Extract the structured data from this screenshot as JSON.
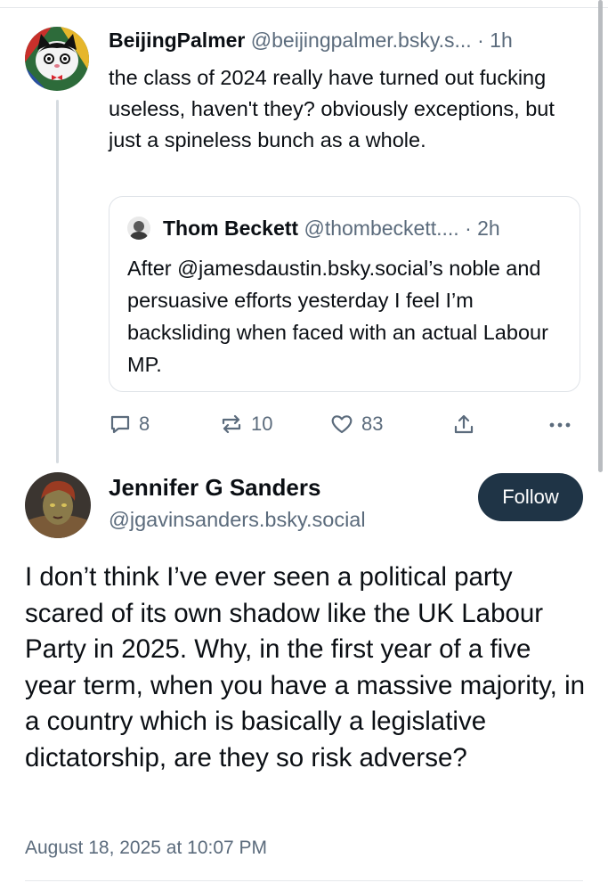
{
  "parent_post": {
    "author_name": "BeijingPalmer",
    "author_handle": "@beijingpalmer.bsky.s...",
    "separator": "·",
    "time": "1h",
    "text": "the class of 2024 really have turned out fucking useless, haven't they? obviously exceptions, but just a spineless bunch as a whole.",
    "quote": {
      "author_name": "Thom Beckett",
      "author_handle": "@thombeckett....",
      "separator": "·",
      "time": "2h",
      "text": "After @jamesdaustin.bsky.social’s noble and persuasive efforts yesterday I feel I’m backsliding when faced with an actual Labour MP."
    },
    "actions": {
      "reply_count": "8",
      "repost_count": "10",
      "like_count": "83",
      "icons": [
        "reply-icon",
        "repost-icon",
        "like-icon",
        "share-icon",
        "more-icon"
      ]
    }
  },
  "main_post": {
    "author_name": "Jennifer G Sanders",
    "author_handle": "@jgavinsanders.bsky.social",
    "follow_label": "Follow",
    "text": "I don’t think I’ve ever seen a political party scared of its own shadow like the UK Labour Party in 2025.  Why, in the first year of a five year term, when you have a massive majority, in a country which is basically a legislative dictatorship, are they so risk adverse?",
    "timestamp": "August 18, 2025 at 10:07 PM"
  },
  "colors": {
    "text": "#0b0f14",
    "muted": "#5b6b7c",
    "follow_bg": "#1f3446",
    "border": "#dfe3e8"
  }
}
